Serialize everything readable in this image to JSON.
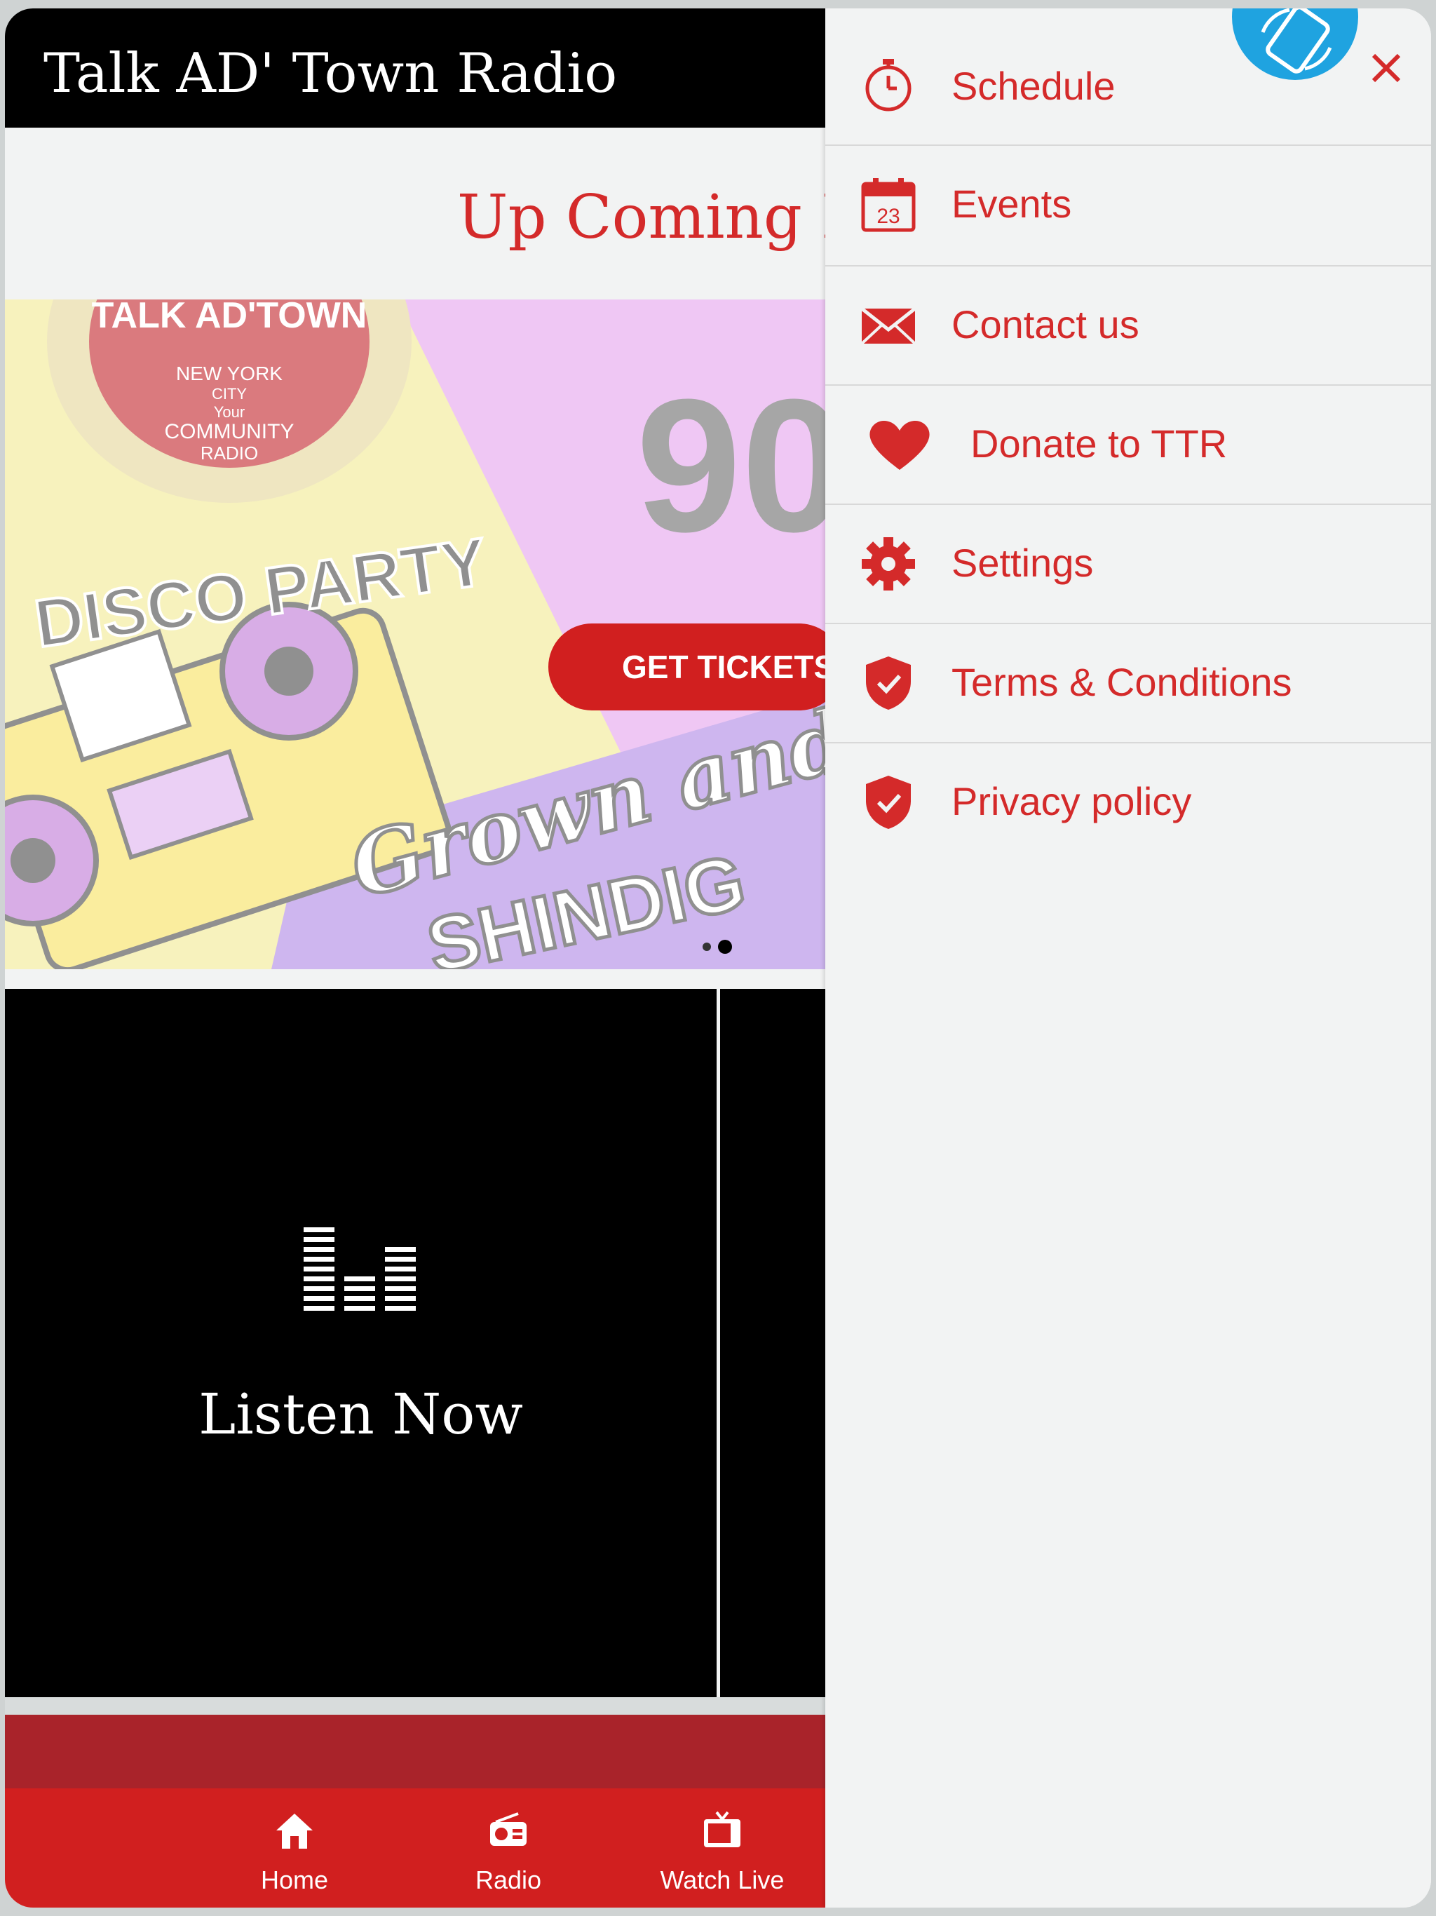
{
  "app": {
    "title": "Talk AD' Town Radio",
    "accent_color": "#d42a2a"
  },
  "upcoming": {
    "title": "Up Coming E"
  },
  "carousel": {
    "banner_text": {
      "logo_line1": "TALK AD'TOWN",
      "logo_line2": "NEW YORK",
      "logo_line3": "CITY",
      "logo_line4": "Your",
      "logo_line5": "COMMUNITY",
      "logo_line6": "RADIO",
      "headline": "DISCO PARTY",
      "decade": "90",
      "script1": "Grown and",
      "script2": "SHINDIG"
    },
    "ticket_button": "GET TICKETS",
    "active_slide": 2,
    "slide_count": 2
  },
  "listen": {
    "label": "Listen Now",
    "icon": "equalizer-icon"
  },
  "tabs": [
    {
      "label": "Home",
      "icon": "home-icon"
    },
    {
      "label": "Radio",
      "icon": "radio-icon"
    },
    {
      "label": "Watch Live",
      "icon": "tv-icon"
    }
  ],
  "drawer": {
    "items": [
      {
        "label": "Schedule",
        "icon": "stopwatch-icon"
      },
      {
        "label": "Events",
        "icon": "calendar-icon",
        "calendar_day": "23"
      },
      {
        "label": "Contact us",
        "icon": "envelope-icon"
      },
      {
        "label": "Donate to TTR",
        "icon": "heart-icon"
      },
      {
        "label": "Settings",
        "icon": "gear-icon"
      },
      {
        "label": "Terms & Conditions",
        "icon": "shield-check-icon"
      },
      {
        "label": "Privacy policy",
        "icon": "shield-check-icon"
      }
    ],
    "close_icon": "close-icon",
    "rotate_icon": "rotate-device-icon",
    "rotate_color": "#1fa3e0"
  }
}
